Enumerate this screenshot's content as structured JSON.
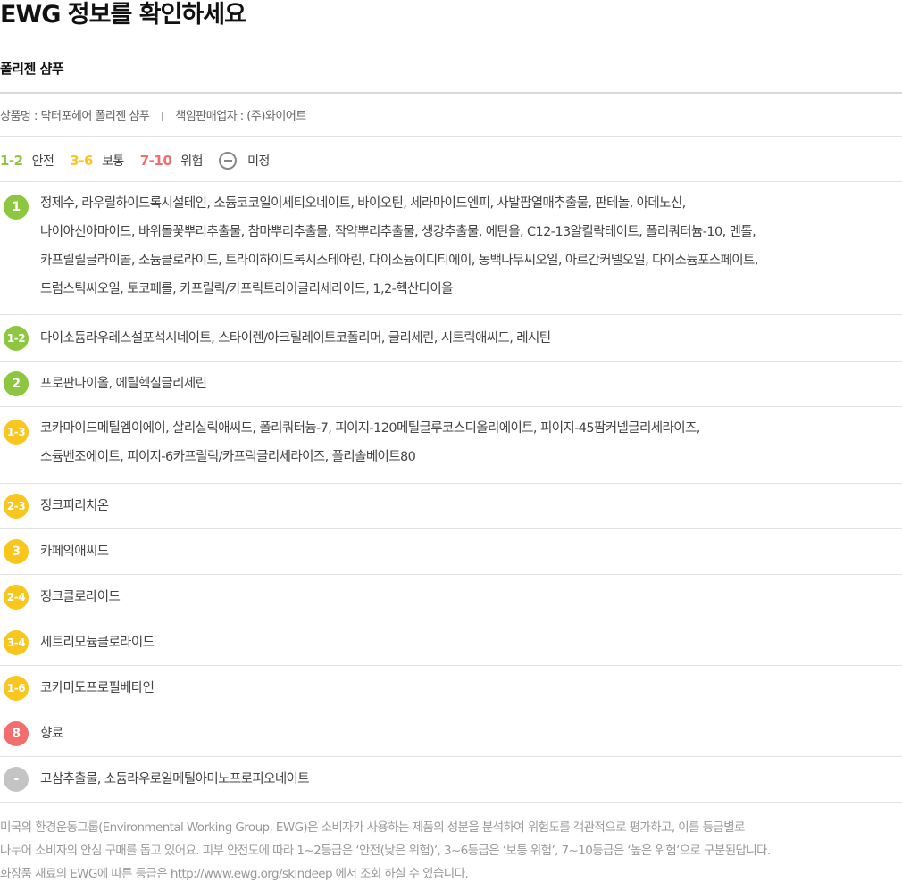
{
  "title": "EWG 정보를 확인하세요",
  "product_name": "폴리젠 샴푸",
  "meta": {
    "product": "상품명 : 닥터포헤어 폴리젠 샴푸",
    "seller": "책임판매업자 : (주)와이어트"
  },
  "legend": [
    {
      "range": "1-2",
      "label": "안전",
      "color": "#8dc63f"
    },
    {
      "range": "3-6",
      "label": "보통",
      "color": "#f9c61e"
    },
    {
      "range": "7-10",
      "label": "위험",
      "color": "#f26d6d"
    },
    {
      "range": "",
      "label": "미정",
      "color": "#888888"
    }
  ],
  "rows": [
    {
      "grade": "1",
      "color": "#8dc63f",
      "lines": [
        "정제수, 라우릴하이드록시설테인, 소듐코코일이세티오네이트, 바이오틴, 세라마이드엔피, 사발팜열매추출물, 판테놀, 아데노신,",
        "나이아신아마이드, 바위돌꽃뿌리추출물, 참마뿌리추출물, 작약뿌리추출물, 생강추출물, 에탄올, C12-13알킬락테이트, 폴리쿼터늄-10, 멘톨,",
        "카프릴릴글라이콜, 소듐클로라이드, 트라이하이드록시스테아린, 다이소듐이디티에이, 동백나무씨오일, 아르간커넬오일, 다이소듐포스페이트,",
        "드럼스틱씨오일, 토코페롤, 카프릴릭/카프릭트라이글리세라이드, 1,2-헥산다이올"
      ]
    },
    {
      "grade": "1-2",
      "color": "#8dc63f",
      "lines": [
        "다이소듐라우레스설포석시네이트, 스타이렌/아크릴레이트코폴리머, 글리세린, 시트릭애씨드, 레시틴"
      ]
    },
    {
      "grade": "2",
      "color": "#8dc63f",
      "lines": [
        "프로판다이올, 에틸헥실글리세린"
      ]
    },
    {
      "grade": "1-3",
      "color": "#f9c61e",
      "lines": [
        "코카마이드메틸엠이에이, 살리실릭애씨드, 폴리쿼터늄-7, 피이지-120메틸글루코스디올리에이트, 피이지-45팜커넬글리세라이즈,",
        "소듐벤조에이트, 피이지-6카프릴릭/카프릭글리세라이즈, 폴리솔베이트80"
      ]
    },
    {
      "grade": "2-3",
      "color": "#f9c61e",
      "lines": [
        "징크피리치온"
      ]
    },
    {
      "grade": "3",
      "color": "#f9c61e",
      "lines": [
        "카페익애씨드"
      ]
    },
    {
      "grade": "2-4",
      "color": "#f9c61e",
      "lines": [
        "징크클로라이드"
      ]
    },
    {
      "grade": "3-4",
      "color": "#f9c61e",
      "lines": [
        "세트리모늄클로라이드"
      ]
    },
    {
      "grade": "1-6",
      "color": "#f9c61e",
      "lines": [
        "코카미도프로필베타인"
      ]
    },
    {
      "grade": "8",
      "color": "#f26d6d",
      "lines": [
        "향료"
      ]
    },
    {
      "grade": "-",
      "color": "#c4c4c4",
      "lines": [
        "고삼추출물, 소듐라우로일메틸아미노프로피오네이트"
      ]
    }
  ],
  "footer": [
    "미국의 환경운동그룹(Environmental Working Group, EWG)은 소비자가 사용하는 제품의 성분을 분석하여 위험도를 객관적으로 평가하고, 이를 등급별로",
    "나누어 소비자의 안심 구매를 돕고 있어요. 피부 안전도에 따라 1~2등급은 ‘안전(낮은 위험)’, 3~6등급은 ‘보통 위험’, 7~10등급은 ‘높은 위험’으로 구분된답니다.",
    "화장품 재료의 EWG에 따른 등급은 http://www.ewg.org/skindeep 에서 조회 하실 수 있습니다."
  ]
}
